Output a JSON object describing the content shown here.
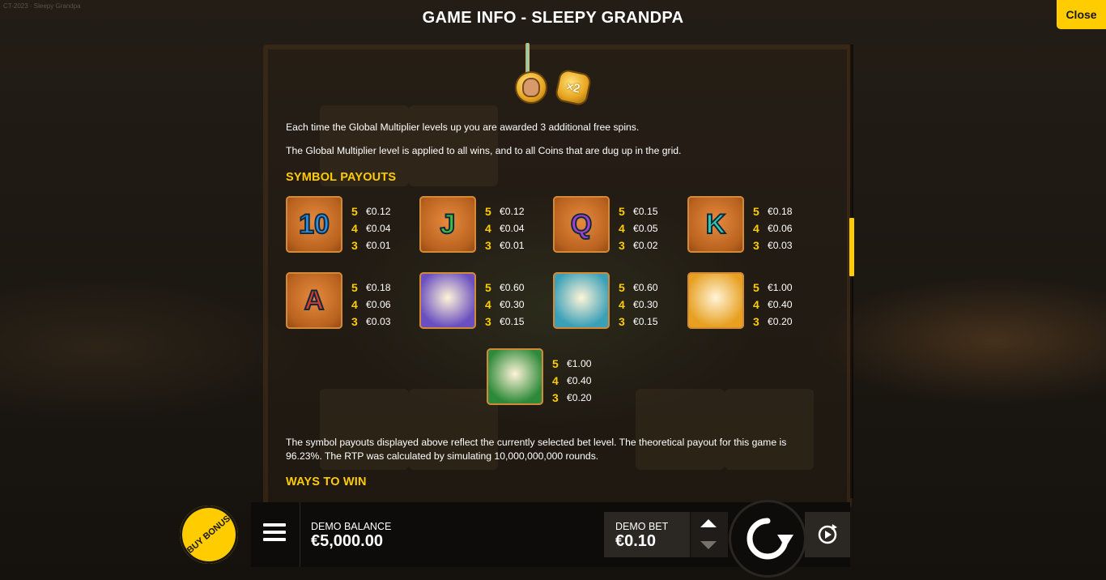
{
  "top_caption": "CT-2023 · Sleepy Grandpa",
  "window": {
    "title": "GAME INFO - SLEEPY GRANDPA",
    "close_label": "Close"
  },
  "feature": {
    "multiplier_coin_label": "×2",
    "line1": "Each time the Global Multiplier levels up you are awarded 3 additional free spins.",
    "line2": "The Global Multiplier level is applied to all wins, and to all Coins that are dug up in the grid."
  },
  "symbol_payouts": {
    "heading": "SYMBOL PAYOUTS",
    "symbols": [
      {
        "glyph": "10",
        "icon": "symbol-10-icon",
        "color": "#2f8fe0",
        "payouts": [
          {
            "n": "5",
            "v": "€0.12"
          },
          {
            "n": "4",
            "v": "€0.04"
          },
          {
            "n": "3",
            "v": "€0.01"
          }
        ]
      },
      {
        "glyph": "J",
        "icon": "symbol-j-icon",
        "color": "#3fbf3f",
        "payouts": [
          {
            "n": "5",
            "v": "€0.12"
          },
          {
            "n": "4",
            "v": "€0.04"
          },
          {
            "n": "3",
            "v": "€0.01"
          }
        ]
      },
      {
        "glyph": "Q",
        "icon": "symbol-q-icon",
        "color": "#a53fd0",
        "payouts": [
          {
            "n": "5",
            "v": "€0.15"
          },
          {
            "n": "4",
            "v": "€0.05"
          },
          {
            "n": "3",
            "v": "€0.02"
          }
        ]
      },
      {
        "glyph": "K",
        "icon": "symbol-k-icon",
        "color": "#2fc8b0",
        "payouts": [
          {
            "n": "5",
            "v": "€0.18"
          },
          {
            "n": "4",
            "v": "€0.06"
          },
          {
            "n": "3",
            "v": "€0.03"
          }
        ]
      },
      {
        "glyph": "A",
        "icon": "symbol-a-icon",
        "color": "#e03a2a",
        "payouts": [
          {
            "n": "5",
            "v": "€0.18"
          },
          {
            "n": "4",
            "v": "€0.06"
          },
          {
            "n": "3",
            "v": "€0.03"
          }
        ]
      },
      {
        "glyph": "",
        "icon": "chicken-icon",
        "color": "#6a4fc0",
        "payouts": [
          {
            "n": "5",
            "v": "€0.60"
          },
          {
            "n": "4",
            "v": "€0.30"
          },
          {
            "n": "3",
            "v": "€0.15"
          }
        ]
      },
      {
        "glyph": "",
        "icon": "sheep-icon",
        "color": "#3aa0b8",
        "payouts": [
          {
            "n": "5",
            "v": "€0.60"
          },
          {
            "n": "4",
            "v": "€0.30"
          },
          {
            "n": "3",
            "v": "€0.15"
          }
        ]
      },
      {
        "glyph": "",
        "icon": "pig-icon",
        "color": "#e7a020",
        "payouts": [
          {
            "n": "5",
            "v": "€1.00"
          },
          {
            "n": "4",
            "v": "€0.40"
          },
          {
            "n": "3",
            "v": "€0.20"
          }
        ]
      },
      {
        "glyph": "",
        "icon": "cow-icon",
        "color": "#2e8a3a",
        "payouts": [
          {
            "n": "5",
            "v": "€1.00"
          },
          {
            "n": "4",
            "v": "€0.40"
          },
          {
            "n": "3",
            "v": "€0.20"
          }
        ]
      }
    ],
    "note": "The symbol payouts displayed above reflect the currently selected bet level. The theoretical payout for this game is 96.23%. The RTP was calculated by simulating 10,000,000,000 rounds."
  },
  "ways_heading": "WAYS TO WIN",
  "bottom_bar": {
    "buy_bonus_label": "BUY BONUS",
    "balance_label": "DEMO BALANCE",
    "balance_value": "€5,000.00",
    "bet_label": "DEMO BET",
    "bet_value": "€0.10"
  },
  "colors": {
    "accent": "#ffcc00"
  }
}
